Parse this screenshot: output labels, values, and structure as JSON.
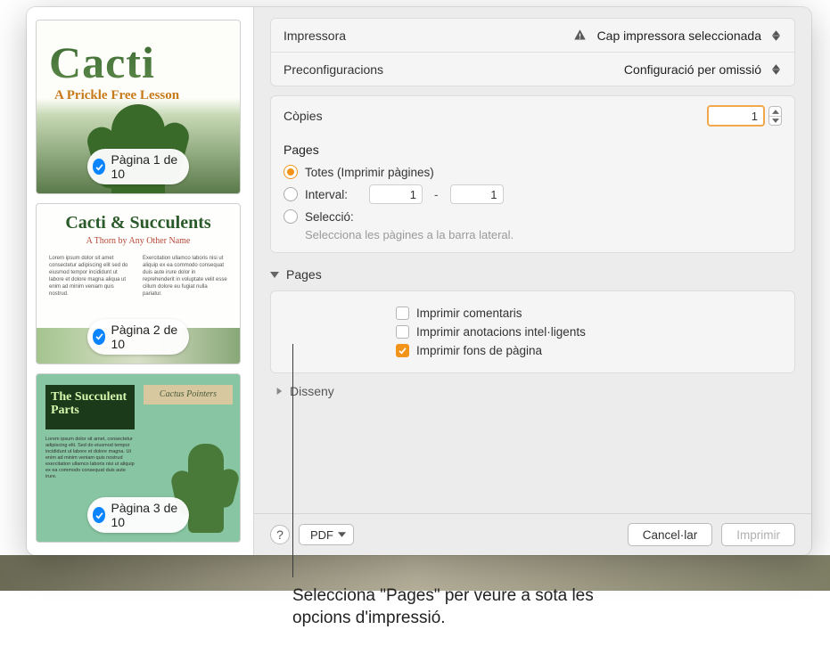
{
  "sidebar": {
    "thumb1": {
      "title": "Cacti",
      "subtitle": "A Prickle Free Lesson",
      "badge": "Pàgina 1 de 10"
    },
    "thumb2": {
      "title": "Cacti & Succulents",
      "subtitle": "A Thorn by Any Other Name",
      "badge": "Pàgina 2 de 10"
    },
    "thumb3": {
      "title": "The Succulent Parts",
      "subtitle": "Cactus Pointers",
      "badge": "Pàgina 3 de 10"
    }
  },
  "printer": {
    "label": "Impressora",
    "value": "Cap impressora seleccionada"
  },
  "presets": {
    "label": "Preconfiguracions",
    "value": "Configuració per omissió"
  },
  "copies": {
    "label": "Còpies",
    "value": "1"
  },
  "pages": {
    "heading": "Pages",
    "all": "Totes (Imprimir pàgines)",
    "range": "Interval:",
    "from": "1",
    "to": "1",
    "selection": "Selecció:",
    "hint": "Selecciona les pàgines a la barra lateral."
  },
  "section_pages": {
    "title": "Pages",
    "opt_comments": "Imprimir comentaris",
    "opt_smart": "Imprimir anotacions intel·ligents",
    "opt_bg": "Imprimir fons de pàgina"
  },
  "section_design": {
    "title": "Disseny"
  },
  "footer": {
    "pdf": "PDF",
    "cancel": "Cancel·lar",
    "print": "Imprimir"
  },
  "callout": "Selecciona \"Pages\" per veure a sota les opcions d'impressió."
}
